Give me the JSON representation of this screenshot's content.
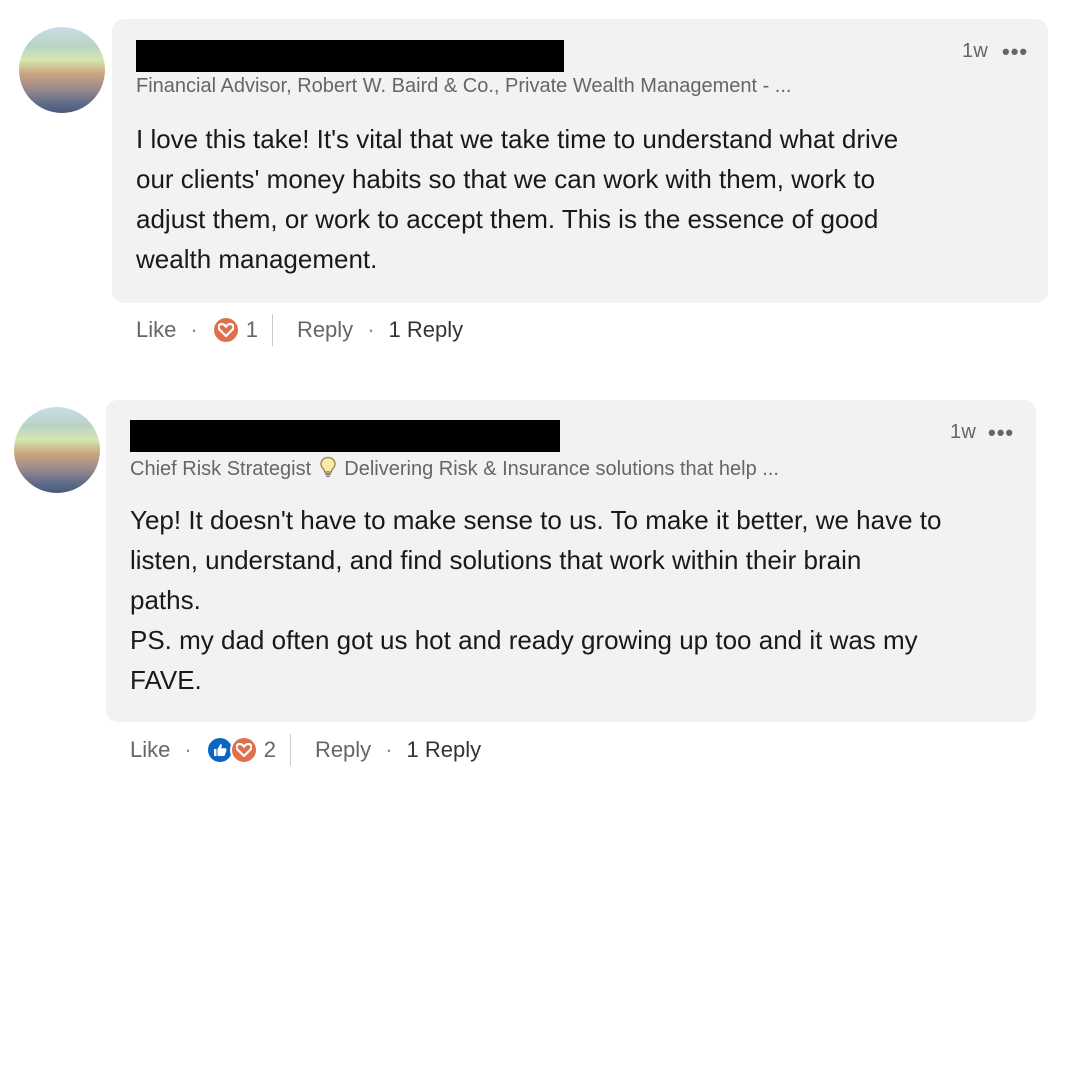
{
  "colors": {
    "bubble_bg": "#f2f2f2",
    "meta_text": "#666666",
    "heart_reaction": "#df704d",
    "like_reaction": "#0a66c2"
  },
  "comments": [
    {
      "time": "1w",
      "more_label": "•••",
      "headline": "Financial Advisor, Robert W. Baird & Co., Private Wealth Management - ...",
      "text": "I love this take! It's vital that we take time to understand what drive\nour clients' money habits so that we can work with them, work to\nadjust them, or work to accept them. This is the essence of good\nwealth management.",
      "like_label": "Like",
      "reaction_icons": [
        "heart-icon"
      ],
      "reaction_count": "1",
      "reply_label": "Reply",
      "replies_label": "1 Reply"
    },
    {
      "time": "1w",
      "more_label": "•••",
      "headline_part1": "Chief Risk Strategist",
      "headline_icon": "lightbulb-icon",
      "headline_part2": "Delivering Risk & Insurance solutions that help ...",
      "text": "Yep! It doesn't have to make sense to us. To make it better, we have to\nlisten, understand, and find solutions that work within their brain\npaths.\nPS. my dad often got us hot and ready growing up too and it was my\nFAVE.",
      "like_label": "Like",
      "reaction_icons": [
        "like-icon",
        "heart-icon"
      ],
      "reaction_count": "2",
      "reply_label": "Reply",
      "replies_label": "1 Reply"
    }
  ],
  "separator": "·"
}
